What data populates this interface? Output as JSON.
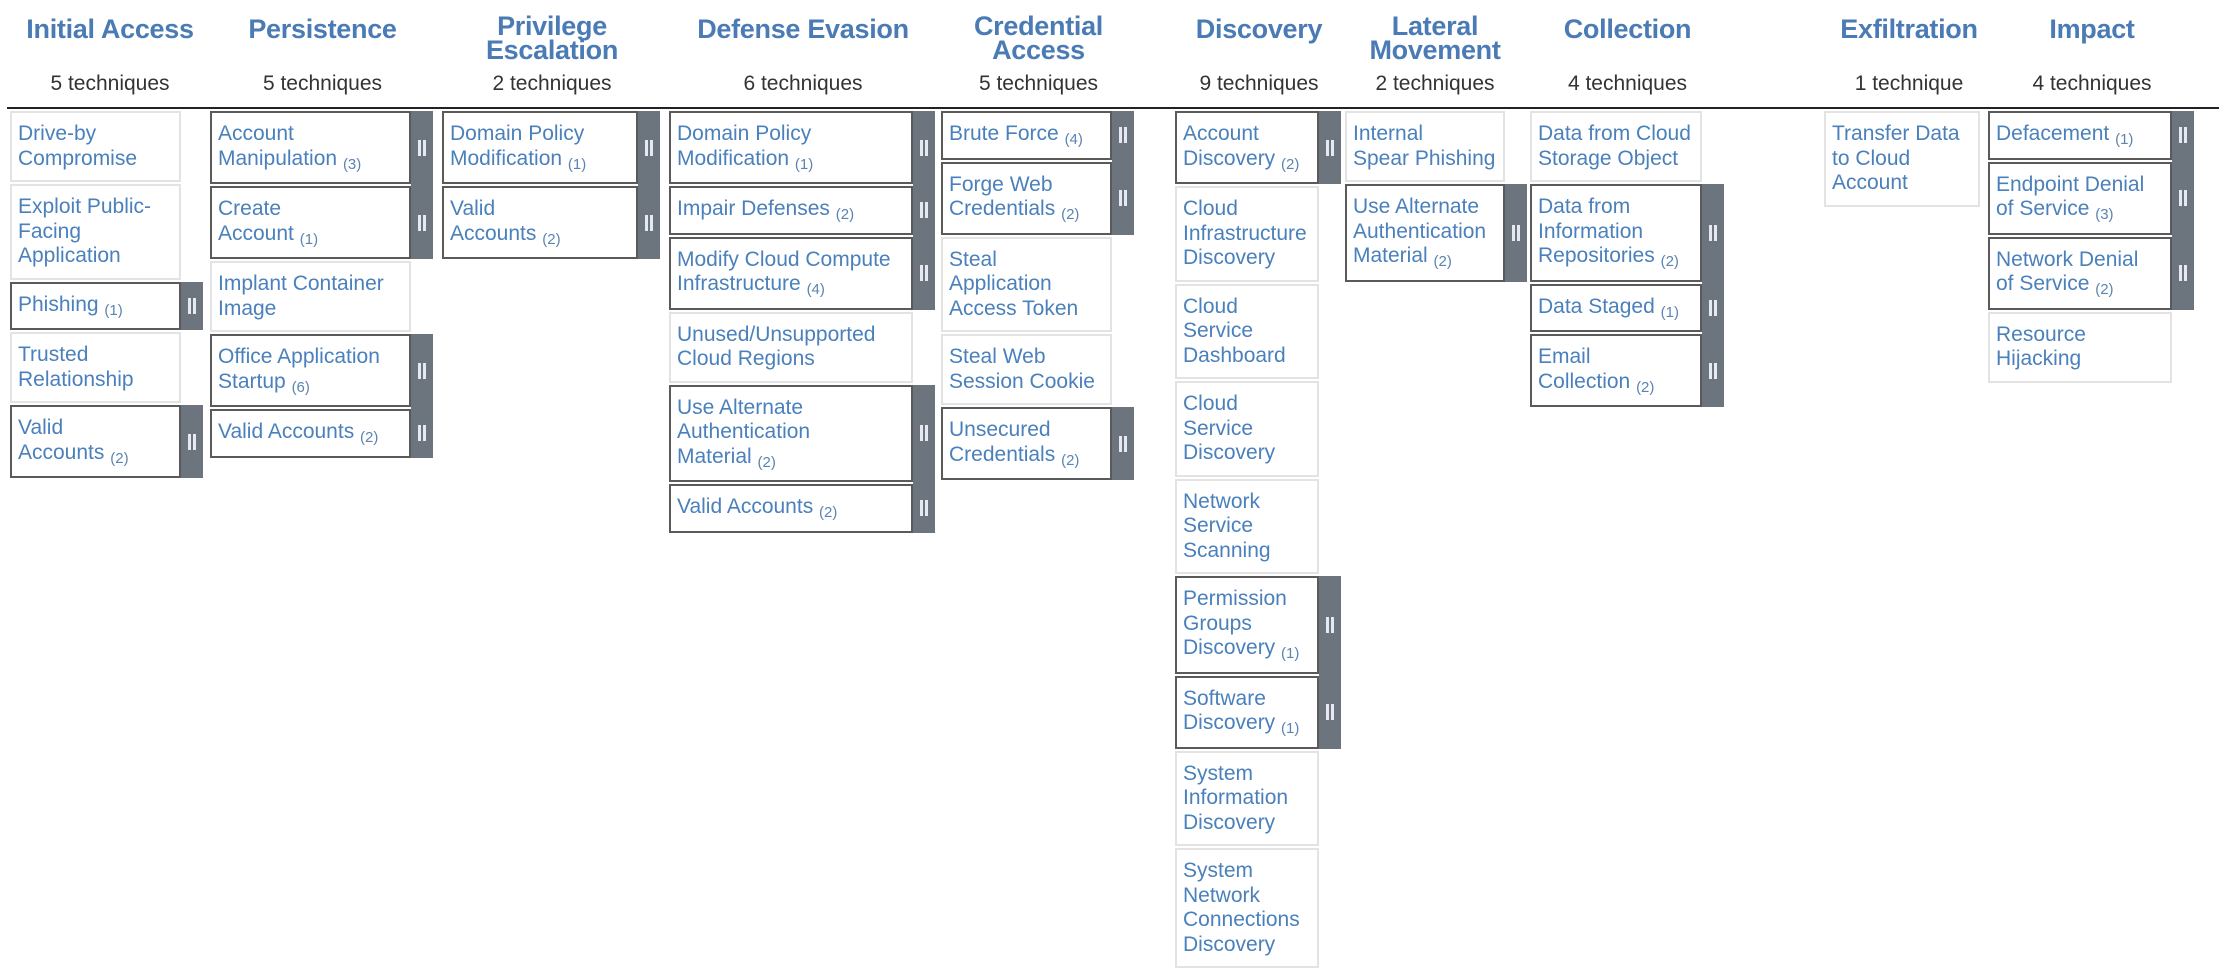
{
  "matrix": {
    "tactics": [
      {
        "name": "Initial Access",
        "count_label": "5 techniques",
        "techniques": [
          {
            "name": "Drive-by Compromise",
            "lines": [
              "Drive-by",
              "Compromise"
            ],
            "subtechniques": null
          },
          {
            "name": "Exploit Public-Facing Application",
            "lines": [
              "Exploit Public-",
              "Facing",
              "Application"
            ],
            "subtechniques": null
          },
          {
            "name": "Phishing",
            "lines": [
              "Phishing"
            ],
            "subtechniques": "(1)"
          },
          {
            "name": "Trusted Relationship",
            "lines": [
              "Trusted",
              "Relationship"
            ],
            "subtechniques": null
          },
          {
            "name": "Valid Accounts",
            "lines": [
              "Valid",
              "Accounts"
            ],
            "subtechniques": "(2)"
          }
        ]
      },
      {
        "name": "Persistence",
        "count_label": "5 techniques",
        "techniques": [
          {
            "name": "Account Manipulation",
            "lines": [
              "Account",
              "Manipulation"
            ],
            "subtechniques": "(3)"
          },
          {
            "name": "Create Account",
            "lines": [
              "Create",
              "Account"
            ],
            "subtechniques": "(1)"
          },
          {
            "name": "Implant Container Image",
            "lines": [
              "Implant Container",
              "Image"
            ],
            "subtechniques": null
          },
          {
            "name": "Office Application Startup",
            "lines": [
              "Office Application",
              "Startup"
            ],
            "subtechniques": "(6)"
          },
          {
            "name": "Valid Accounts",
            "lines": [
              "Valid Accounts"
            ],
            "subtechniques": "(2)"
          }
        ]
      },
      {
        "name": "Privilege Escalation",
        "name_lines": [
          "Privilege",
          "Escalation"
        ],
        "count_label": "2 techniques",
        "techniques": [
          {
            "name": "Domain Policy Modification",
            "lines": [
              "Domain Policy",
              "Modification"
            ],
            "subtechniques": "(1)"
          },
          {
            "name": "Valid Accounts",
            "lines": [
              "Valid",
              "Accounts"
            ],
            "subtechniques": "(2)"
          }
        ]
      },
      {
        "name": "Defense Evasion",
        "count_label": "6 techniques",
        "techniques": [
          {
            "name": "Domain Policy Modification",
            "lines": [
              "Domain Policy",
              "Modification"
            ],
            "subtechniques": "(1)"
          },
          {
            "name": "Impair Defenses",
            "lines": [
              "Impair Defenses"
            ],
            "subtechniques": "(2)"
          },
          {
            "name": "Modify Cloud Compute Infrastructure",
            "lines": [
              "Modify Cloud Compute",
              "Infrastructure"
            ],
            "subtechniques": "(4)"
          },
          {
            "name": "Unused/Unsupported Cloud Regions",
            "lines": [
              "Unused/Unsupported",
              "Cloud Regions"
            ],
            "subtechniques": null
          },
          {
            "name": "Use Alternate Authentication Material",
            "lines": [
              "Use Alternate",
              "Authentication",
              "Material"
            ],
            "subtechniques": "(2)"
          },
          {
            "name": "Valid Accounts",
            "lines": [
              "Valid Accounts"
            ],
            "subtechniques": "(2)"
          }
        ]
      },
      {
        "name": "Credential Access",
        "name_lines": [
          "Credential",
          "Access"
        ],
        "count_label": "5 techniques",
        "techniques": [
          {
            "name": "Brute Force",
            "lines": [
              "Brute Force"
            ],
            "subtechniques": "(4)"
          },
          {
            "name": "Forge Web Credentials",
            "lines": [
              "Forge Web",
              "Credentials"
            ],
            "subtechniques": "(2)"
          },
          {
            "name": "Steal Application Access Token",
            "lines": [
              "Steal",
              "Application",
              "Access Token"
            ],
            "subtechniques": null
          },
          {
            "name": "Steal Web Session Cookie",
            "lines": [
              "Steal Web",
              "Session Cookie"
            ],
            "subtechniques": null
          },
          {
            "name": "Unsecured Credentials",
            "lines": [
              "Unsecured",
              "Credentials"
            ],
            "subtechniques": "(2)"
          }
        ]
      },
      {
        "name": "Discovery",
        "count_label": "9 techniques",
        "techniques": [
          {
            "name": "Account Discovery",
            "lines": [
              "Account",
              "Discovery"
            ],
            "subtechniques": "(2)"
          },
          {
            "name": "Cloud Infrastructure Discovery",
            "lines": [
              "Cloud",
              "Infrastructure",
              "Discovery"
            ],
            "subtechniques": null
          },
          {
            "name": "Cloud Service Dashboard",
            "lines": [
              "Cloud Service",
              "Dashboard"
            ],
            "subtechniques": null
          },
          {
            "name": "Cloud Service Discovery",
            "lines": [
              "Cloud Service",
              "Discovery"
            ],
            "subtechniques": null
          },
          {
            "name": "Network Service Scanning",
            "lines": [
              "Network",
              "Service",
              "Scanning"
            ],
            "subtechniques": null
          },
          {
            "name": "Permission Groups Discovery",
            "lines": [
              "Permission",
              "Groups",
              "Discovery"
            ],
            "subtechniques": "(1)"
          },
          {
            "name": "Software Discovery",
            "lines": [
              "Software",
              "Discovery"
            ],
            "subtechniques": "(1)"
          },
          {
            "name": "System Information Discovery",
            "lines": [
              "System",
              "Information",
              "Discovery"
            ],
            "subtechniques": null
          },
          {
            "name": "System Network Connections Discovery",
            "lines": [
              "System",
              "Network",
              "Connections",
              "Discovery"
            ],
            "subtechniques": null
          }
        ]
      },
      {
        "name": "Lateral Movement",
        "name_lines": [
          "Lateral",
          "Movement"
        ],
        "count_label": "2 techniques",
        "techniques": [
          {
            "name": "Internal Spear Phishing",
            "lines": [
              "Internal",
              "Spear Phishing"
            ],
            "subtechniques": null
          },
          {
            "name": "Use Alternate Authentication Material",
            "lines": [
              "Use Alternate",
              "Authentication",
              "Material"
            ],
            "subtechniques": "(2)"
          }
        ]
      },
      {
        "name": "Collection",
        "count_label": "4 techniques",
        "techniques": [
          {
            "name": "Data from Cloud Storage Object",
            "lines": [
              "Data from Cloud",
              "Storage Object"
            ],
            "subtechniques": null
          },
          {
            "name": "Data from Information Repositories",
            "lines": [
              "Data from",
              "Information",
              "Repositories"
            ],
            "subtechniques": "(2)"
          },
          {
            "name": "Data Staged",
            "lines": [
              "Data Staged"
            ],
            "subtechniques": "(1)"
          },
          {
            "name": "Email Collection",
            "lines": [
              "Email",
              "Collection"
            ],
            "subtechniques": "(2)"
          }
        ]
      },
      {
        "name": "Exfiltration",
        "count_label": "1 technique",
        "techniques": [
          {
            "name": "Transfer Data to Cloud Account",
            "lines": [
              "Transfer Data",
              "to Cloud",
              "Account"
            ],
            "subtechniques": null
          }
        ]
      },
      {
        "name": "Impact",
        "count_label": "4 techniques",
        "techniques": [
          {
            "name": "Defacement",
            "lines": [
              "Defacement"
            ],
            "subtechniques": "(1)"
          },
          {
            "name": "Endpoint Denial of Service",
            "lines": [
              "Endpoint Denial",
              "of Service"
            ],
            "subtechniques": "(3)"
          },
          {
            "name": "Network Denial of Service",
            "lines": [
              "Network Denial",
              "of Service"
            ],
            "subtechniques": "(2)"
          },
          {
            "name": "Resource Hijacking",
            "lines": [
              "Resource",
              "Hijacking"
            ],
            "subtechniques": null
          }
        ]
      }
    ]
  },
  "icons": {
    "sidebar_toggle": "subtechniques-toggle-icon"
  },
  "colors": {
    "tactic_header": "#4a7bb5",
    "technique_text": "#4a80bb",
    "count_text": "#333333",
    "sidebar": "#6c757d",
    "subtechnique_border": "#5a5a5a",
    "plain_border": "#e3e3e3"
  }
}
